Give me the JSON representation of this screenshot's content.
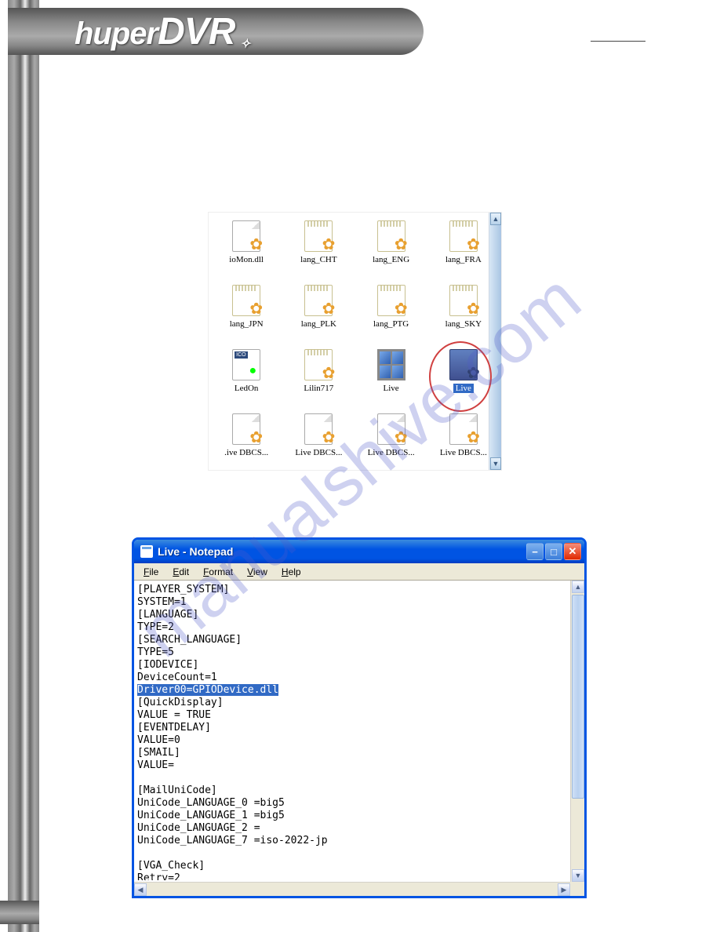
{
  "watermark_text": "manualshive.com",
  "explorer": {
    "files": [
      {
        "label": "ioMon.dll",
        "icon": "page-gear"
      },
      {
        "label": "lang_CHT",
        "icon": "ini"
      },
      {
        "label": "lang_ENG",
        "icon": "ini"
      },
      {
        "label": "lang_FRA",
        "icon": "ini"
      },
      {
        "label": "lang_JPN",
        "icon": "ini"
      },
      {
        "label": "lang_PLK",
        "icon": "ini"
      },
      {
        "label": "lang_PTG",
        "icon": "ini"
      },
      {
        "label": "lang_SKY",
        "icon": "ini"
      },
      {
        "label": "LedOn",
        "icon": "ico"
      },
      {
        "label": "Lilin717",
        "icon": "ini"
      },
      {
        "label": "Live",
        "icon": "panes"
      },
      {
        "label": "Live",
        "icon": "ini-sel",
        "selected": true,
        "circled": true
      },
      {
        "label": ".ive DBCS...",
        "icon": "page-gear"
      },
      {
        "label": "Live DBCS...",
        "icon": "page-gear"
      },
      {
        "label": "Live DBCS...",
        "icon": "page-gear"
      },
      {
        "label": "Live DBCS...",
        "icon": "page-gear"
      }
    ],
    "scroll": {
      "up": "▲",
      "down": "▼"
    }
  },
  "notepad": {
    "title": "Live - Notepad",
    "menu": [
      "File",
      "Edit",
      "Format",
      "View",
      "Help"
    ],
    "window_buttons": {
      "min": "−",
      "max": "□",
      "close": "✕"
    },
    "content_before": "[PLAYER_SYSTEM]\nSYSTEM=1\n[LANGUAGE]\nTYPE=2\n[SEARCH_LANGUAGE]\nTYPE=5\n[IODEVICE]\nDeviceCount=1\n",
    "content_highlight": "Driver00=GPIODevice.dll",
    "content_after": "\n[QuickDisplay]\nVALUE = TRUE\n[EVENTDELAY]\nVALUE=0\n[SMAIL]\nVALUE=\n\n[MailUniCode]\nUniCode_LANGUAGE_0 =big5\nUniCode_LANGUAGE_1 =big5\nUniCode_LANGUAGE_2 =\nUniCode_LANGUAGE_7 =iso-2022-jp\n\n[VGA_Check]\nRetry=2",
    "scroll": {
      "up": "▲",
      "down": "▼",
      "left": "◀",
      "right": "▶"
    }
  },
  "logo": {
    "prefix": "huper",
    "suffix": "DVR"
  }
}
